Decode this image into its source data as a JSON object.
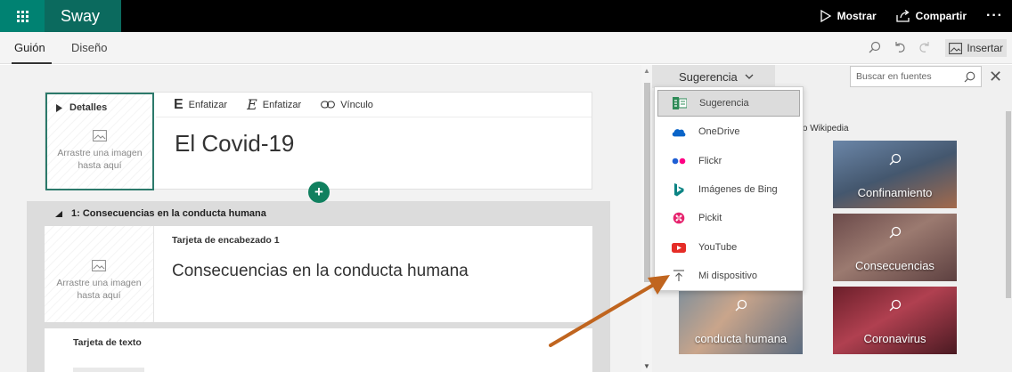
{
  "app": {
    "name": "Sway",
    "show_label": "Mostrar",
    "share_label": "Compartir",
    "more_label": "···"
  },
  "tabs": {
    "storyline": "Guión",
    "design": "Diseño",
    "insert_label": "Insertar"
  },
  "title_card": {
    "details_label": "Detalles",
    "image_placeholder_line1": "Arrastre una imagen",
    "image_placeholder_line2": "hasta aquí",
    "emphasize_bold": "Enfatizar",
    "emphasize_italic": "Enfatizar",
    "link_label": "Vínculo",
    "title": "El Covid-19"
  },
  "section": {
    "heading": "1: Consecuencias en la conducta humana",
    "heading_card_label": "Tarjeta de encabezado 1",
    "heading_card_text": "Consecuencias en la conducta humana",
    "image_placeholder_line1": "Arrastre una imagen",
    "image_placeholder_line2": "hasta aquí",
    "text_card_label": "Tarjeta de texto"
  },
  "panel": {
    "source_selected": "Sugerencia",
    "search_placeholder": "Buscar en fuentes",
    "hint_text": "be o Wikipedia",
    "tiles": [
      {
        "label": ""
      },
      {
        "label": "Confinamiento"
      },
      {
        "label": ""
      },
      {
        "label": "Consecuencias"
      },
      {
        "label": "conducta humana"
      },
      {
        "label": "Coronavirus"
      }
    ]
  },
  "dropdown": {
    "items": [
      {
        "label": "Sugerencia",
        "icon": "suggestion-icon",
        "selected": true
      },
      {
        "label": "OneDrive",
        "icon": "onedrive-icon",
        "selected": false
      },
      {
        "label": "Flickr",
        "icon": "flickr-icon",
        "selected": false
      },
      {
        "label": "Imágenes de Bing",
        "icon": "bing-icon",
        "selected": false
      },
      {
        "label": "Pickit",
        "icon": "pickit-icon",
        "selected": false
      },
      {
        "label": "YouTube",
        "icon": "youtube-icon",
        "selected": false
      },
      {
        "label": "Mi dispositivo",
        "icon": "upload-icon",
        "selected": false
      }
    ]
  },
  "colors": {
    "brand_teal": "#008272",
    "plus_green": "#10805f",
    "arrow_orange": "#c0651f"
  }
}
